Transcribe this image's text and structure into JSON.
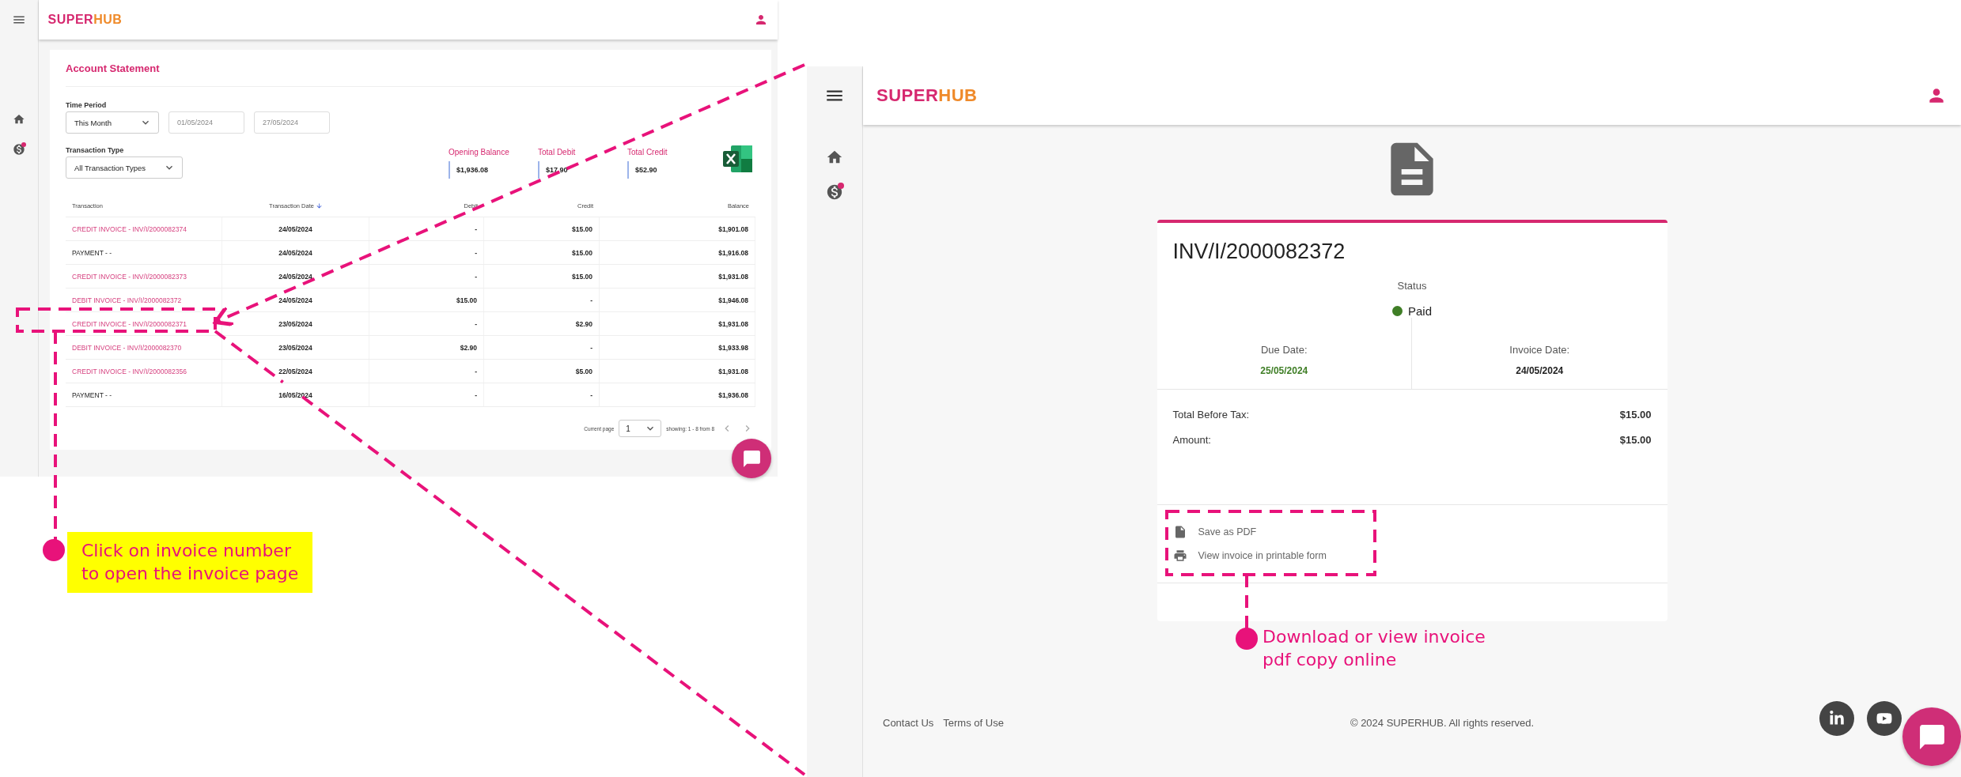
{
  "left_screen": {
    "logo": {
      "first": "SUPER",
      "second": "HUB"
    },
    "title": "Account Statement",
    "time_period": {
      "label": "Time Period",
      "value": "This Month",
      "from": "01/05/2024",
      "to": "27/05/2024"
    },
    "transaction_type": {
      "label": "Transaction Type",
      "value": "All Transaction Types"
    },
    "summary": [
      {
        "label": "Opening Balance",
        "value": "$1,936.08"
      },
      {
        "label": "Total Debit",
        "value": "$17.90"
      },
      {
        "label": "Total Credit",
        "value": "$52.90"
      }
    ],
    "table": {
      "columns": [
        "Transaction",
        "Transaction Date",
        "Debit",
        "Credit",
        "Balance"
      ],
      "rows": [
        {
          "kind": "invoice",
          "cells": [
            "CREDIT INVOICE - INV/I/2000082374",
            "24/05/2024",
            "-",
            "$15.00",
            "$1,901.08"
          ]
        },
        {
          "kind": "payment",
          "cells": [
            "PAYMENT - -",
            "24/05/2024",
            "-",
            "$15.00",
            "$1,916.08"
          ]
        },
        {
          "kind": "invoice",
          "cells": [
            "CREDIT INVOICE - INV/I/2000082373",
            "24/05/2024",
            "-",
            "$15.00",
            "$1,931.08"
          ]
        },
        {
          "kind": "invoice",
          "cells": [
            "DEBIT INVOICE - INV/I/2000082372",
            "24/05/2024",
            "$15.00",
            "-",
            "$1,946.08"
          ]
        },
        {
          "kind": "invoice",
          "cells": [
            "CREDIT INVOICE - INV/I/2000082371",
            "23/05/2024",
            "-",
            "$2.90",
            "$1,931.08"
          ]
        },
        {
          "kind": "invoice",
          "cells": [
            "DEBIT INVOICE - INV/I/2000082370",
            "23/05/2024",
            "$2.90",
            "-",
            "$1,933.98"
          ]
        },
        {
          "kind": "invoice",
          "cells": [
            "CREDIT INVOICE - INV/I/2000082356",
            "22/05/2024",
            "-",
            "$5.00",
            "$1,931.08"
          ]
        },
        {
          "kind": "payment",
          "cells": [
            "PAYMENT - -",
            "16/05/2024",
            "-",
            "-",
            "$1,936.08"
          ]
        }
      ]
    },
    "pagination": {
      "label": "Current page",
      "page": "1",
      "showing": "showing: 1 - 8 from 8"
    }
  },
  "right_screen": {
    "logo": {
      "first": "SUPER",
      "second": "HUB"
    },
    "invoice": {
      "number": "INV/I/2000082372",
      "status_label": "Status",
      "status": "Paid",
      "dates": [
        {
          "kind": "due",
          "label": "Due Date:",
          "value": "25/05/2024"
        },
        {
          "kind": "issued",
          "label": "Invoice Date:",
          "value": "24/05/2024"
        }
      ],
      "totals": [
        {
          "label": "Total Before Tax:",
          "value": "$15.00"
        },
        {
          "label": "Amount:",
          "value": "$15.00"
        }
      ],
      "actions": [
        {
          "kind": "pdf",
          "label": "Save as PDF"
        },
        {
          "kind": "print",
          "label": "View invoice in printable form"
        }
      ]
    },
    "footer": {
      "links": [
        "Contact Us",
        "Terms of Use"
      ],
      "copyright": "© 2024 SUPERHUB. All rights reserved."
    }
  },
  "annotations": [
    {
      "kind": "highlighted",
      "lines": [
        "Click on invoice number",
        "to open the invoice page"
      ]
    },
    {
      "kind": "plain",
      "lines": [
        "Download or view invoice",
        "pdf copy online"
      ]
    }
  ]
}
